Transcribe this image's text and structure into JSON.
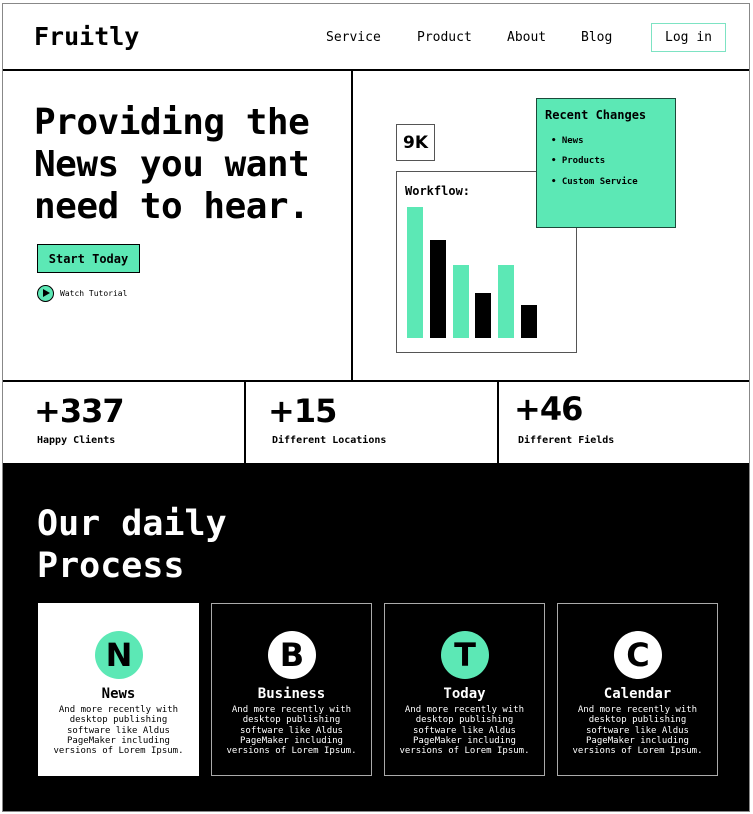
{
  "header": {
    "logo": "Fruitly",
    "nav": [
      "Service",
      "Product",
      "About",
      "Blog"
    ],
    "login": "Log in"
  },
  "hero": {
    "title_lines": [
      "Providing the",
      "News you want",
      "need to hear."
    ],
    "cta": "Start Today",
    "watch": "Watch Tutorial",
    "stat_badge": "9K",
    "workflow": {
      "title": "Workflow:",
      "bar_values": [
        100,
        75,
        56,
        34,
        56,
        25
      ],
      "bar_colors": [
        "#5ce8b5",
        "#000000",
        "#5ce8b5",
        "#000000",
        "#5ce8b5",
        "#000000"
      ]
    },
    "recent": {
      "title": "Recent Changes",
      "items": [
        "News",
        "Products",
        "Custom Service"
      ]
    }
  },
  "stats": [
    {
      "value": "+337",
      "label": "Happy Clients"
    },
    {
      "value": "+15",
      "label": "Different Locations"
    },
    {
      "value": "+46",
      "label": "Different Fields"
    }
  ],
  "process": {
    "title_lines": [
      "Our daily",
      "Process"
    ],
    "cards": [
      {
        "letter": "N",
        "title": "News",
        "desc": "And more recently with desktop publishing software like Aldus PageMaker including versions of Lorem Ipsum.",
        "circle": "#5ce8b5"
      },
      {
        "letter": "B",
        "title": "Business",
        "desc": "And more recently with desktop publishing software like Aldus PageMaker including versions of Lorem Ipsum.",
        "circle": "#ffffff"
      },
      {
        "letter": "T",
        "title": "Today",
        "desc": "And more recently with desktop publishing software like Aldus PageMaker including versions of Lorem Ipsum.",
        "circle": "#5ce8b5"
      },
      {
        "letter": "C",
        "title": "Calendar",
        "desc": "And more recently with desktop publishing software like Aldus PageMaker including versions of Lorem Ipsum.",
        "circle": "#ffffff"
      }
    ]
  },
  "colors": {
    "accent": "#5ce8b5"
  }
}
